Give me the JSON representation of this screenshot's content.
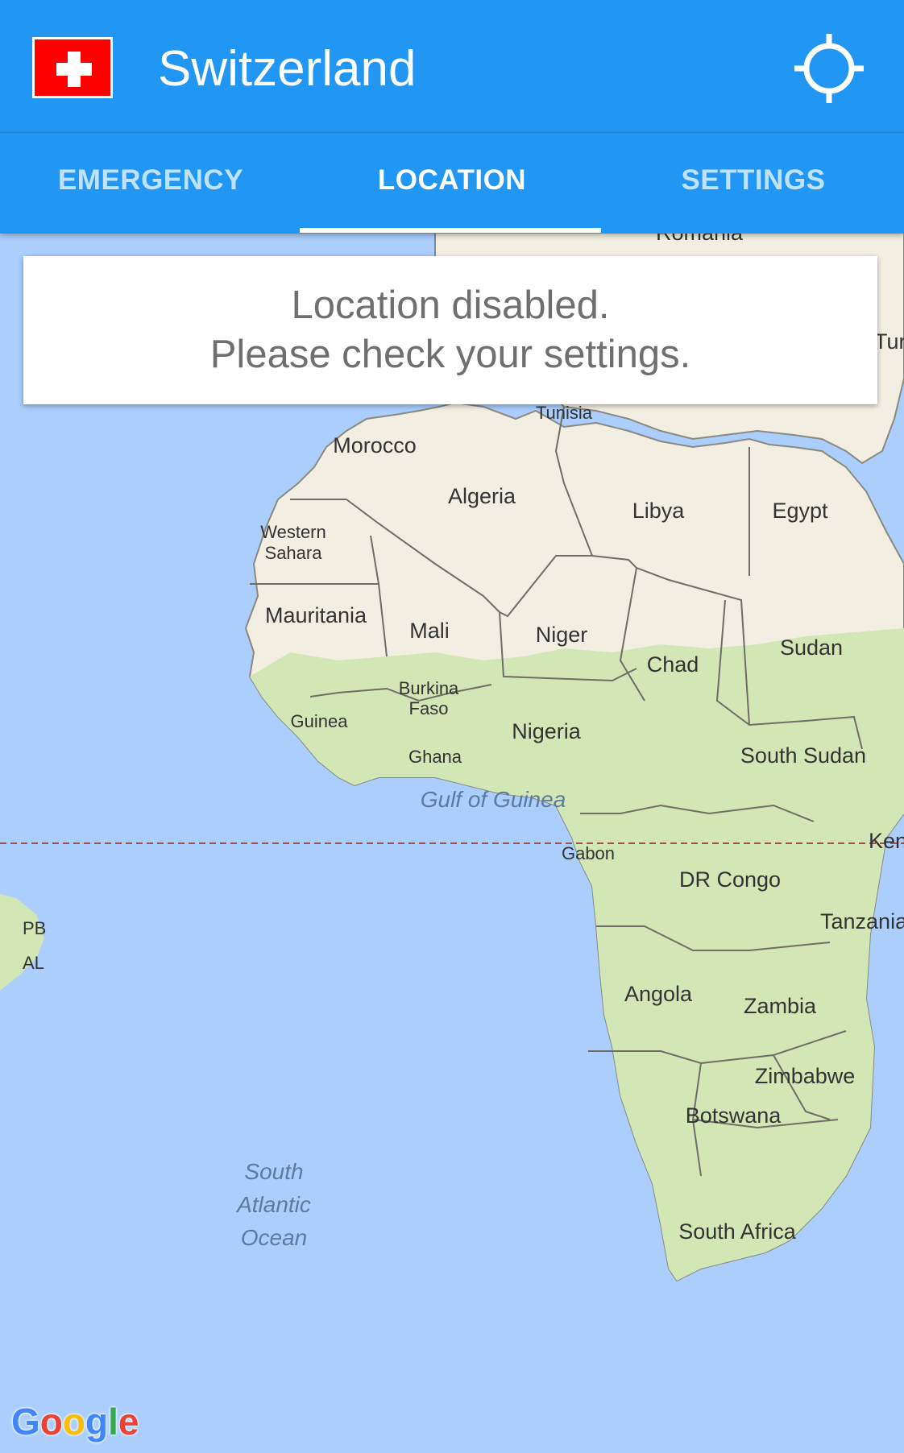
{
  "header": {
    "title": "Switzerland",
    "flag_icon": "swiss-flag-icon",
    "locate_icon": "crosshair-icon",
    "bg_color": "#2196f3"
  },
  "tabs": [
    {
      "label": "EMERGENCY",
      "active": false
    },
    {
      "label": "LOCATION",
      "active": true
    },
    {
      "label": "SETTINGS",
      "active": false
    }
  ],
  "notice": {
    "line1": "Location disabled.",
    "line2": "Please check your settings."
  },
  "map": {
    "countries": [
      "Romania",
      "Tunisia",
      "Morocco",
      "Algeria",
      "Libya",
      "Egypt",
      "Western",
      "Sahara",
      "Mauritania",
      "Mali",
      "Niger",
      "Sudan",
      "Chad",
      "Burkina",
      "Faso",
      "Guinea",
      "Nigeria",
      "Ghana",
      "South Sudan",
      "Gabon",
      "DR Congo",
      "Tanzania",
      "Angola",
      "Zambia",
      "Zimbabwe",
      "Botswana",
      "South Africa",
      "Kenya",
      "Turkey",
      "PB",
      "AL"
    ],
    "water": [
      "Gulf of Guinea",
      "South",
      "Atlantic",
      "Ocean"
    ],
    "logo": [
      "G",
      "o",
      "o",
      "g",
      "l",
      "e"
    ],
    "logo_colors": [
      "#4285f4",
      "#ea4335",
      "#fbbc05",
      "#4285f4",
      "#34a853",
      "#ea4335"
    ],
    "ocean_color": "#abcefd",
    "land_color": "#f2efe2",
    "vegetation_color": "#d3e6b6"
  }
}
